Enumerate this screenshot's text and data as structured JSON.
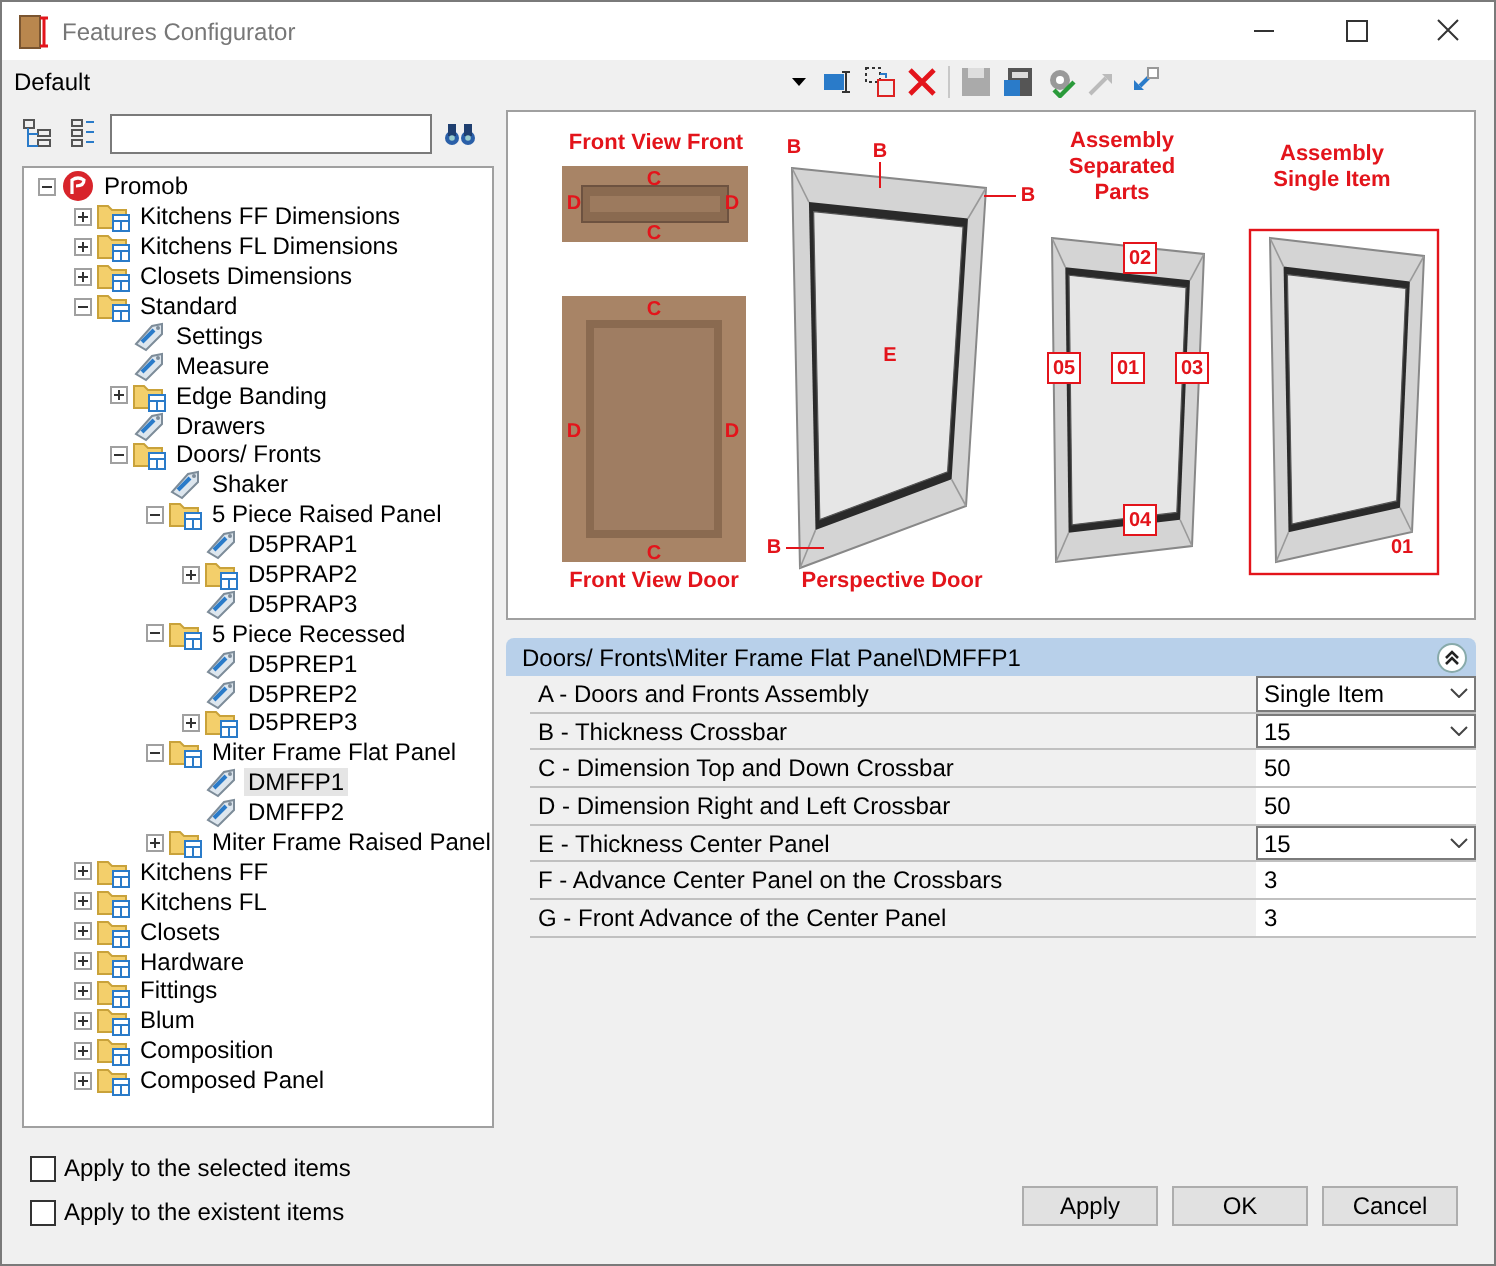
{
  "window": {
    "title": "Features Configurator"
  },
  "toolbar": {
    "profile": "Default"
  },
  "tree": [
    {
      "label": "Promob",
      "kind": "root",
      "expanded": true,
      "selected": false,
      "children": [
        {
          "label": "Kitchens FF Dimensions",
          "kind": "folder",
          "expanded": false,
          "selected": false
        },
        {
          "label": "Kitchens FL Dimensions",
          "kind": "folder",
          "expanded": false,
          "selected": false
        },
        {
          "label": "Closets Dimensions",
          "kind": "folder",
          "expanded": false,
          "selected": false
        },
        {
          "label": "Standard",
          "kind": "folder",
          "expanded": true,
          "selected": false,
          "children": [
            {
              "label": "Settings",
              "kind": "item",
              "selected": false
            },
            {
              "label": "Measure",
              "kind": "item",
              "selected": false
            },
            {
              "label": "Edge Banding",
              "kind": "folder",
              "expanded": false,
              "selected": false
            },
            {
              "label": "Drawers",
              "kind": "item",
              "selected": false
            },
            {
              "label": "Doors/ Fronts",
              "kind": "folder",
              "expanded": true,
              "selected": false,
              "children": [
                {
                  "label": "Shaker",
                  "kind": "item",
                  "selected": false
                },
                {
                  "label": "5 Piece Raised Panel",
                  "kind": "folder",
                  "expanded": true,
                  "selected": false,
                  "children": [
                    {
                      "label": "D5PRAP1",
                      "kind": "item",
                      "selected": false
                    },
                    {
                      "label": "D5PRAP2",
                      "kind": "folder",
                      "expanded": false,
                      "selected": false
                    },
                    {
                      "label": "D5PRAP3",
                      "kind": "item",
                      "selected": false
                    }
                  ]
                },
                {
                  "label": "5 Piece Recessed",
                  "kind": "folder",
                  "expanded": true,
                  "selected": false,
                  "children": [
                    {
                      "label": "D5PREP1",
                      "kind": "item",
                      "selected": false
                    },
                    {
                      "label": "D5PREP2",
                      "kind": "item",
                      "selected": false
                    },
                    {
                      "label": "D5PREP3",
                      "kind": "folder",
                      "expanded": false,
                      "selected": false
                    }
                  ]
                },
                {
                  "label": "Miter Frame Flat Panel",
                  "kind": "folder",
                  "expanded": true,
                  "selected": false,
                  "children": [
                    {
                      "label": "DMFFP1",
                      "kind": "item",
                      "selected": true
                    },
                    {
                      "label": "DMFFP2",
                      "kind": "item",
                      "selected": false
                    }
                  ]
                },
                {
                  "label": "Miter Frame Raised Panel",
                  "kind": "folder",
                  "expanded": false,
                  "selected": false
                }
              ]
            }
          ]
        },
        {
          "label": "Kitchens FF",
          "kind": "folder",
          "expanded": false,
          "selected": false
        },
        {
          "label": "Kitchens FL",
          "kind": "folder",
          "expanded": false,
          "selected": false
        },
        {
          "label": "Closets",
          "kind": "folder",
          "expanded": false,
          "selected": false
        },
        {
          "label": "Hardware",
          "kind": "folder",
          "expanded": false,
          "selected": false
        },
        {
          "label": "Fittings",
          "kind": "folder",
          "expanded": false,
          "selected": false
        },
        {
          "label": "Blum",
          "kind": "folder",
          "expanded": false,
          "selected": false
        },
        {
          "label": "Composition",
          "kind": "folder",
          "expanded": false,
          "selected": false
        },
        {
          "label": "Composed Panel",
          "kind": "folder",
          "expanded": false,
          "selected": false
        }
      ]
    }
  ],
  "diagram": {
    "captions": [
      "Front View Front",
      "Front View Door",
      "Perspective Door",
      "Assembly Separated Parts",
      "Assembly Single Item"
    ],
    "dimension_labels": [
      "C",
      "D",
      "D",
      "C",
      "C",
      "D",
      "D",
      "C",
      "B",
      "B",
      "B",
      "B",
      "E"
    ],
    "assembly_parts": [
      "02",
      "05",
      "01",
      "03",
      "04"
    ],
    "single_item_label": "01"
  },
  "properties": {
    "path": "Doors/ Fronts\\Miter Frame Flat Panel\\DMFFP1",
    "expanded": true,
    "rows": [
      {
        "label": "A - Doors and Fronts Assembly",
        "kind": "dropdown",
        "value": "Single Item"
      },
      {
        "label": "B - Thickness Crossbar",
        "kind": "dropdown",
        "value": "15"
      },
      {
        "label": "C - Dimension Top and Down Crossbar",
        "kind": "text",
        "value": "50"
      },
      {
        "label": "D - Dimension Right and Left Crossbar",
        "kind": "text",
        "value": "50"
      },
      {
        "label": "E - Thickness Center Panel",
        "kind": "dropdown",
        "value": "15"
      },
      {
        "label": "F - Advance Center Panel on the Crossbars",
        "kind": "text",
        "value": "3"
      },
      {
        "label": "G - Front Advance of the Center Panel",
        "kind": "text",
        "value": "3"
      }
    ]
  },
  "options": [
    {
      "label": "Apply to the selected items",
      "checked": false
    },
    {
      "label": "Apply to the existent items",
      "checked": false
    }
  ],
  "buttons": [
    "Apply",
    "OK",
    "Cancel"
  ]
}
